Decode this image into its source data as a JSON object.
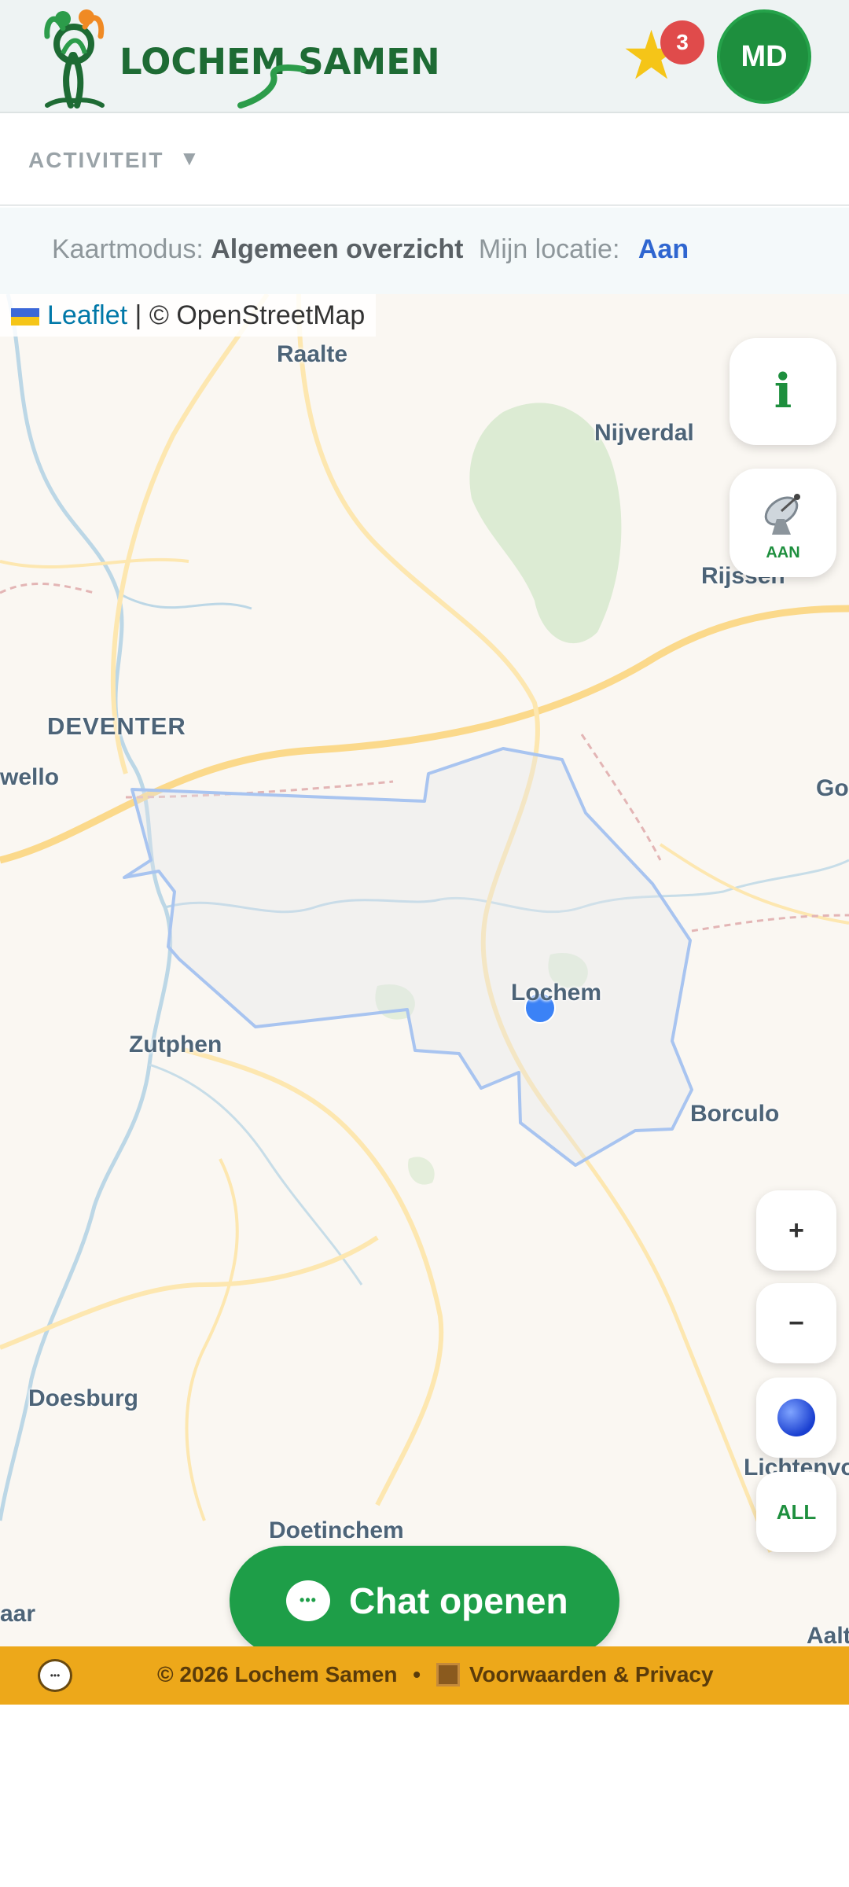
{
  "header": {
    "brand": "LOCHEM SAMEN",
    "notification_count": "3",
    "avatar_initials": "MD"
  },
  "activity": {
    "label": "ACTIVITEIT",
    "caret": "▼"
  },
  "modebar": {
    "mode_label": "Kaartmodus:",
    "mode_value": "Algemeen overzicht",
    "location_label": "Mijn locatie:",
    "location_value": "Aan"
  },
  "map": {
    "attribution_leaflet": "Leaflet",
    "attribution_sep": " | © OpenStreetMap",
    "places": {
      "raalte": "Raalte",
      "nijverdal": "Nijverdal",
      "rijssen": "Rijssen",
      "deventer": "DEVENTER",
      "twello": "wello",
      "goor": "Go",
      "lochem": "Lochem",
      "zutphen": "Zutphen",
      "borculo": "Borculo",
      "doesburg": "Doesburg",
      "lichtenvoorde": "Lichtenvo",
      "doetinchem": "Doetinchem",
      "zevenaar": "aar",
      "aalten": "Aalt"
    },
    "controls": {
      "info": "i",
      "satellite_status": "AAN",
      "zoom_in": "+",
      "zoom_out": "−",
      "all": "ALL"
    },
    "chat_button": "Chat openen"
  },
  "footer": {
    "copyright": "© 2026 Lochem Samen",
    "separator": "•",
    "terms": "Voorwaarden & Privacy"
  },
  "colors": {
    "brand_green": "#1e8f3e",
    "footer_orange": "#eda81a",
    "location_blue": "#2f66d0",
    "badge_red": "#e04b4b"
  },
  "icons": {
    "logo": "tree-people-logo",
    "notifications": "star-icon",
    "info": "info-icon",
    "satellite": "satellite-dish-icon",
    "location": "globe-icon",
    "chat": "chat-bubble-icon",
    "terms": "book-icon"
  }
}
